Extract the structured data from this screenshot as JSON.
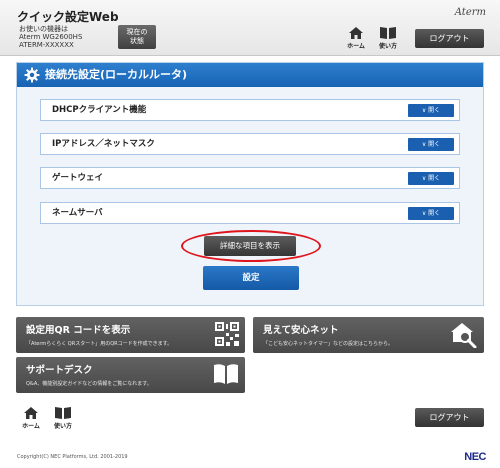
{
  "header": {
    "app_title": "クイック設定Web",
    "device_lines": [
      "お使いの機器は",
      "Aterm WG2600HS",
      "ATERM-XXXXXX"
    ],
    "status_button": [
      "現在の",
      "状態"
    ],
    "brand": "Aterm",
    "home_label": "ホーム",
    "manual_label": "使い方",
    "logout_label": "ログアウト"
  },
  "panel": {
    "title": "接続先設定(ローカルルータ)",
    "rows": [
      {
        "label": "DHCPクライアント機能",
        "button": "∨ 開く"
      },
      {
        "label": "IPアドレス／ネットマスク",
        "button": "∨ 開く"
      },
      {
        "label": "ゲートウェイ",
        "button": "∨ 開く"
      },
      {
        "label": "ネームサーバ",
        "button": "∨ 開く"
      }
    ],
    "detail_button": "詳細な項目を表示",
    "set_button": "設定"
  },
  "tiles": {
    "qr": {
      "title": "設定用QR コードを表示",
      "desc": "「Atermらくらく QRスタート」用のQRコードを作成できます。"
    },
    "safe": {
      "title": "見えて安心ネット",
      "desc": "「こども安心ネットタイマー」などの設定はこちらから。"
    },
    "support": {
      "title": "サポートデスク",
      "desc": "Q&A、機能別設定ガイドなどの情報をご覧になれます。"
    }
  },
  "footer": {
    "home_label": "ホーム",
    "manual_label": "使い方",
    "logout_label": "ログアウト",
    "copyright": "Copyright(C) NEC Platforms, Ltd. 2001-2019",
    "nec": "NEC"
  }
}
